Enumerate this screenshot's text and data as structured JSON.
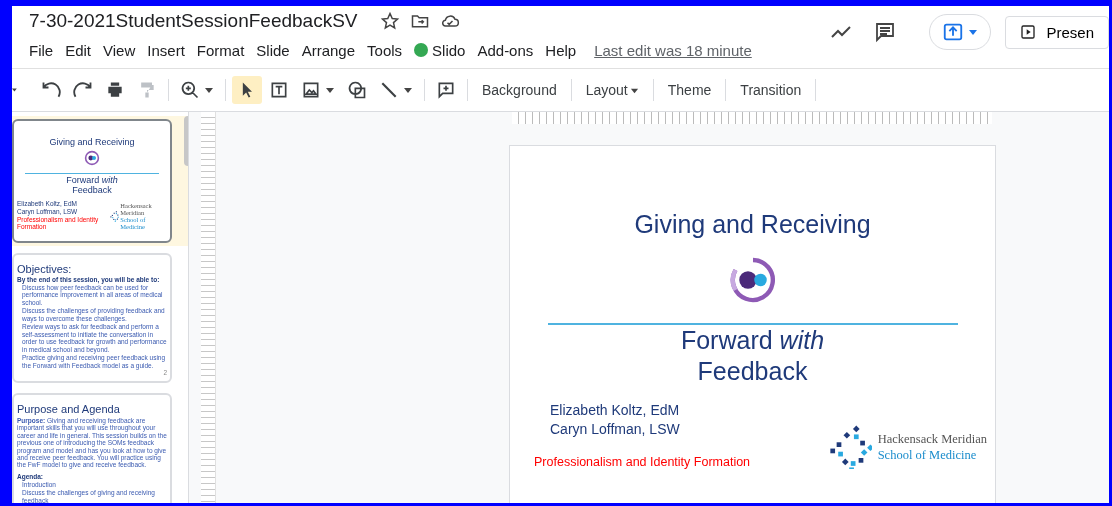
{
  "document": {
    "title": "7-30-2021StudentSessionFeedbackSV",
    "last_edit": "Last edit was 18 minute"
  },
  "menu": [
    {
      "label": "File",
      "kind": "text"
    },
    {
      "label": "Edit",
      "kind": "text"
    },
    {
      "label": "View",
      "kind": "text"
    },
    {
      "label": "Insert",
      "kind": "text"
    },
    {
      "label": "Format",
      "kind": "text"
    },
    {
      "label": "Slide",
      "kind": "text"
    },
    {
      "label": "Arrange",
      "kind": "text"
    },
    {
      "label": "Tools",
      "kind": "text"
    },
    {
      "label": "Slido",
      "kind": "addon"
    },
    {
      "label": "Add-ons",
      "kind": "text"
    },
    {
      "label": "Help",
      "kind": "text"
    }
  ],
  "present_button": {
    "label": "Presen"
  },
  "toolbar": [
    {
      "kind": "undo",
      "selected": false,
      "disabled": false,
      "dropdown": false
    },
    {
      "kind": "redo",
      "selected": false,
      "disabled": false,
      "dropdown": false
    },
    {
      "kind": "print",
      "selected": false,
      "disabled": false,
      "dropdown": false
    },
    {
      "kind": "paint",
      "selected": false,
      "disabled": true,
      "dropdown": false
    },
    {
      "kind": "zoom",
      "selected": false,
      "disabled": false,
      "dropdown": true
    },
    {
      "kind": "select",
      "selected": true,
      "disabled": false,
      "dropdown": false
    },
    {
      "kind": "textbox",
      "selected": false,
      "disabled": false,
      "dropdown": false
    },
    {
      "kind": "image",
      "selected": false,
      "disabled": false,
      "dropdown": true
    },
    {
      "kind": "shape",
      "selected": false,
      "disabled": false,
      "dropdown": false
    },
    {
      "kind": "line",
      "selected": false,
      "disabled": false,
      "dropdown": true
    },
    {
      "kind": "comment",
      "selected": false,
      "disabled": false,
      "dropdown": false
    }
  ],
  "toolbar_text_buttons": [
    {
      "label": "Background",
      "dropdown": false
    },
    {
      "label": "Layout",
      "dropdown": true
    },
    {
      "label": "Theme",
      "dropdown": false
    },
    {
      "label": "Transition",
      "dropdown": false
    }
  ],
  "thumbnails": [
    {
      "kind": "title",
      "selected": true,
      "title": "Giving and Receiving",
      "subtitle_1": "Forward *with*",
      "subtitle_2": "Feedback",
      "authors": [
        "Elizabeth Koltz, EdM",
        "Caryn Loffman, LSW"
      ],
      "footer": "Professionalism and Identity Formation",
      "logo_1": "Hackensack Meridian",
      "logo_2": "School of Medicine"
    },
    {
      "kind": "bullets",
      "selected": false,
      "heading": "Objectives:",
      "intro": "By the end of this session, you will be able to:",
      "bullets": [
        "Discuss how peer feedback can be used for performance improvement in all areas of medical school.",
        "Discuss the challenges of providing feedback and ways to overcome these challenges.",
        "Review ways to ask for feedback and perform a self-assessment to initiate the conversation in order to use feedback for growth and performance in medical school and beyond.",
        "Practice giving and receiving peer feedback using the Forward with Feedback model as a guide."
      ],
      "page": "2"
    },
    {
      "kind": "agenda",
      "selected": false,
      "heading": "Purpose and Agenda",
      "paragraph": "**Purpose:** Giving and receiving feedback are important skills that you will use throughout your career and life in general. This session builds on the previous one of introducing the SOMs feedback program and model and has you look at how to give and receive peer feedback. You will practice using the FwF model to give and receive feedback.",
      "intro": "Agenda:",
      "bullets": [
        "Introduction",
        "Discuss the challenges of giving and receiving feedback"
      ]
    }
  ],
  "slide": {
    "title": "Giving and Receiving",
    "subtitle_1": "Forward *with*",
    "subtitle_2": "Feedback",
    "authors": [
      "Elizabeth Koltz, EdM",
      "Caryn Loffman, LSW"
    ],
    "footer": "Professionalism and Identity Formation",
    "logo_1": "Hackensack Meridian",
    "logo_2": "School of Medicine"
  }
}
